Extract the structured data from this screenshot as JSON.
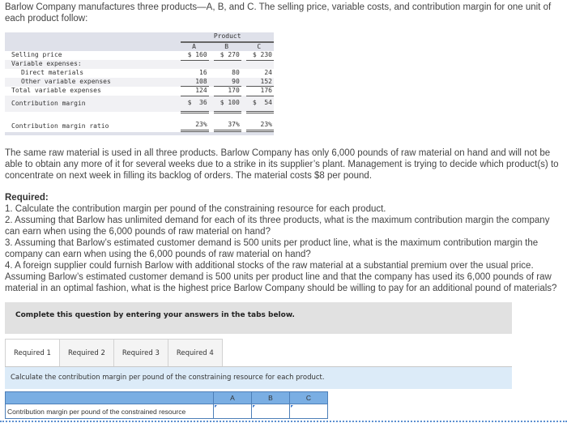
{
  "intro": "Barlow Company manufactures three products—A, B, and C. The selling price, variable costs, and contribution margin for one unit of each product follow:",
  "product_table": {
    "group_header": "Product",
    "columns": [
      "A",
      "B",
      "C"
    ],
    "rows": [
      {
        "label": "Selling price",
        "values": [
          "$ 160",
          "$ 270",
          "$ 230"
        ]
      },
      {
        "label": "Variable expenses:",
        "values": [
          "",
          "",
          ""
        ]
      },
      {
        "label": "Direct materials",
        "values": [
          "16",
          "80",
          "24"
        ]
      },
      {
        "label": "Other variable expenses",
        "values": [
          "108",
          "90",
          "152"
        ]
      },
      {
        "label": "Total variable expenses",
        "values": [
          "124",
          "170",
          "176"
        ]
      },
      {
        "label": "Contribution margin",
        "values": [
          "$  36",
          "$ 100",
          "$  54"
        ]
      },
      {
        "label": "Contribution margin ratio",
        "values": [
          "23%",
          "37%",
          "23%"
        ]
      }
    ]
  },
  "paragraph_raw": "The same raw material is used in all three products. Barlow Company has only 6,000 pounds of raw material on hand and will not be able to obtain any more of it for several weeks due to a strike in its supplier’s plant. Management is trying to decide which product(s) to concentrate on next week in filling its backlog of orders. The material costs $8 per pound.",
  "required": {
    "title": "Required:",
    "items": [
      "1. Calculate the contribution margin per pound of the constraining resource for each product.",
      "2. Assuming that Barlow has unlimited demand for each of its three products, what is the maximum contribution margin the company can earn when using the 6,000 pounds of raw material on hand?",
      "3. Assuming that Barlow’s estimated customer demand is 500 units per product line, what is the maximum contribution margin the company can earn when using the 6,000 pounds of raw material on hand?",
      "4. A foreign supplier could furnish Barlow with additional stocks of the raw material at a substantial premium over the usual price. Assuming Barlow’s estimated customer demand is 500 units per product line and that the company has used its 6,000 pounds of raw material in an optimal fashion, what is the highest price Barlow Company should be willing to pay for an additional pound of materials?"
    ]
  },
  "instructions": "Complete this question by entering your answers in the tabs below.",
  "tabs": [
    {
      "label": "Required 1",
      "active": true
    },
    {
      "label": "Required 2",
      "active": false
    },
    {
      "label": "Required 3",
      "active": false
    },
    {
      "label": "Required 4",
      "active": false
    }
  ],
  "task_prompt": "Calculate the contribution margin per pound of the constraining resource for each product.",
  "answer_table": {
    "columns": [
      "",
      "A",
      "B",
      "C"
    ],
    "row_label": "Contribution margin per pound of the constrained resource",
    "values": [
      "",
      "",
      ""
    ]
  },
  "colors": {
    "answer_header": "#7aaee3",
    "prompt_bg": "#dcebf8",
    "instructions_bg": "#e1e1e1"
  }
}
